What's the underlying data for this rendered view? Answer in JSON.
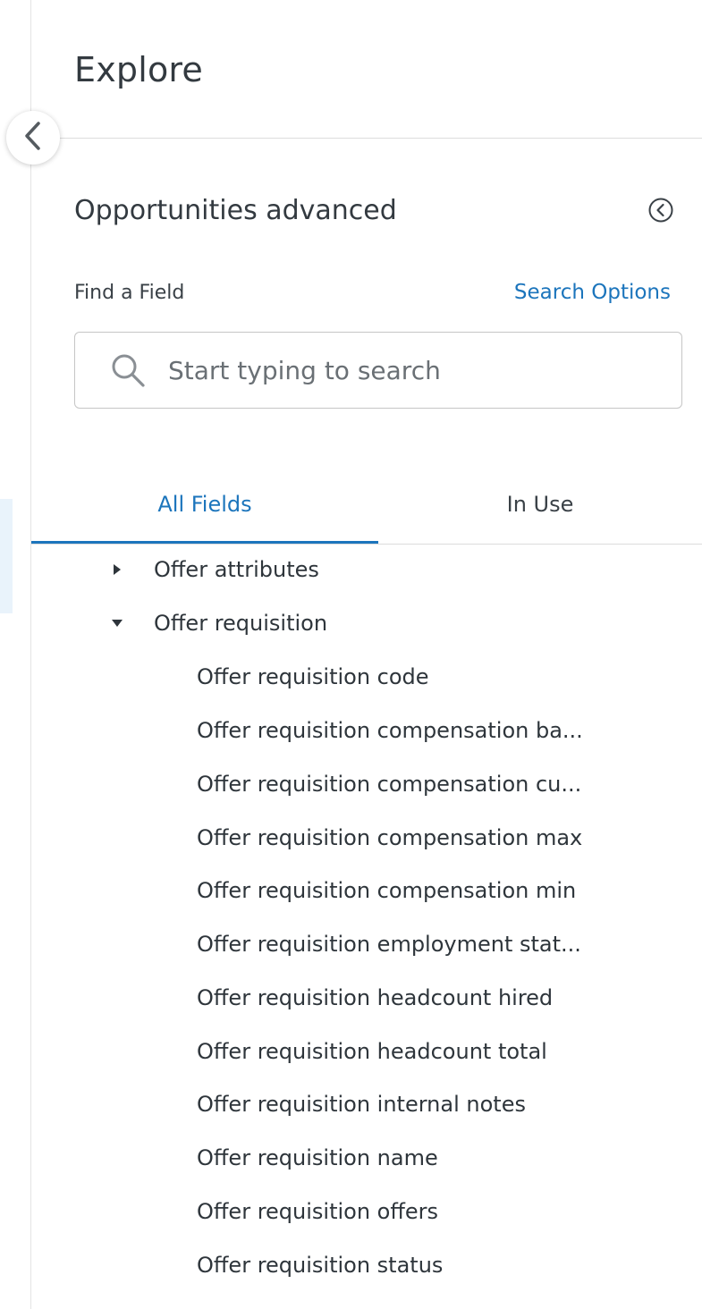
{
  "header": {
    "title": "Explore"
  },
  "explore": {
    "name": "Opportunities advanced"
  },
  "search": {
    "label": "Find a Field",
    "options_link": "Search Options",
    "placeholder": "Start typing to search",
    "value": ""
  },
  "tabs": [
    {
      "label": "All Fields",
      "active": true
    },
    {
      "label": "In Use",
      "active": false
    }
  ],
  "tree": {
    "groups": [
      {
        "label": "Offer attributes",
        "expanded": false
      },
      {
        "label": "Offer requisition",
        "expanded": true
      }
    ],
    "fields": [
      "Offer requisition code",
      "Offer requisition compensation ba...",
      "Offer requisition compensation cu...",
      "Offer requisition compensation max",
      "Offer requisition compensation min",
      "Offer requisition employment stat...",
      "Offer requisition headcount hired",
      "Offer requisition headcount total",
      "Offer requisition internal notes",
      "Offer requisition name",
      "Offer requisition offers",
      "Offer requisition status"
    ]
  },
  "icons": {
    "collapse": "chevron-left-icon",
    "info": "circle-chevron-left-icon",
    "search": "search-icon",
    "collapsed_caret": "caret-right-icon",
    "expanded_caret": "caret-down-icon"
  },
  "colors": {
    "accent": "#1c75bc",
    "text": "#2e353b",
    "divider": "#dcdcdc"
  }
}
